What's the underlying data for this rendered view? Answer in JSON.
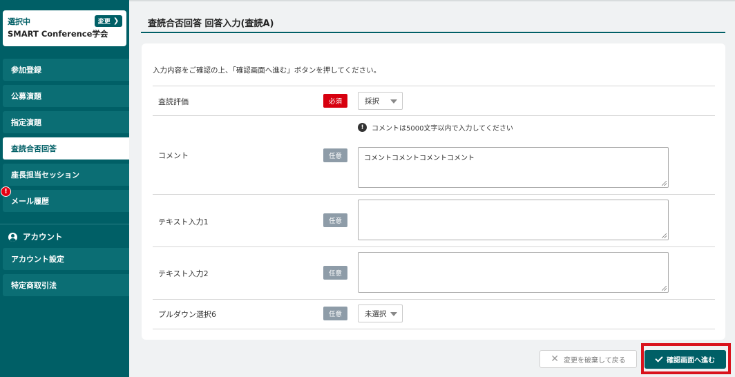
{
  "sidebar": {
    "conference": {
      "selected_label": "選択中",
      "name": "SMART Conference学会",
      "change_label": "変更",
      "change_icon": "chevron-right-icon"
    },
    "items": [
      {
        "label": "参加登録"
      },
      {
        "label": "公募演題"
      },
      {
        "label": "指定演題"
      },
      {
        "label": "査読合否回答",
        "active": true
      },
      {
        "label": "座長担当セッション"
      },
      {
        "label": "メール履歴",
        "badge": "!"
      }
    ],
    "account_section": {
      "title": "アカウント",
      "icon": "user-icon",
      "items": [
        {
          "label": "アカウント設定"
        },
        {
          "label": "特定商取引法"
        }
      ]
    }
  },
  "main": {
    "title": "査読合否回答 回答入力(査読A)",
    "intro": "入力内容をご確認の上、「確認画面へ進む」ボタンを押してください。",
    "fields": [
      {
        "label": "査読評価",
        "badge": "必須",
        "type": "select",
        "value": "採択"
      },
      {
        "label": "コメント",
        "badge": "任意",
        "type": "textarea",
        "notice": "コメントは5000文字以内で入力してください",
        "value": "コメントコメントコメントコメント"
      },
      {
        "label": "テキスト入力1",
        "badge": "任意",
        "type": "textarea",
        "value": ""
      },
      {
        "label": "テキスト入力2",
        "badge": "任意",
        "type": "textarea",
        "value": ""
      },
      {
        "label": "プルダウン選択6",
        "badge": "任意",
        "type": "select",
        "value": "未選択"
      }
    ],
    "buttons": {
      "discard": "変更を破棄して戻る",
      "confirm": "確認画面へ進む"
    }
  },
  "colors": {
    "brand": "#005f66",
    "required": "#d7000f",
    "optional": "#8e9ca8",
    "highlight": "#d9121c"
  }
}
